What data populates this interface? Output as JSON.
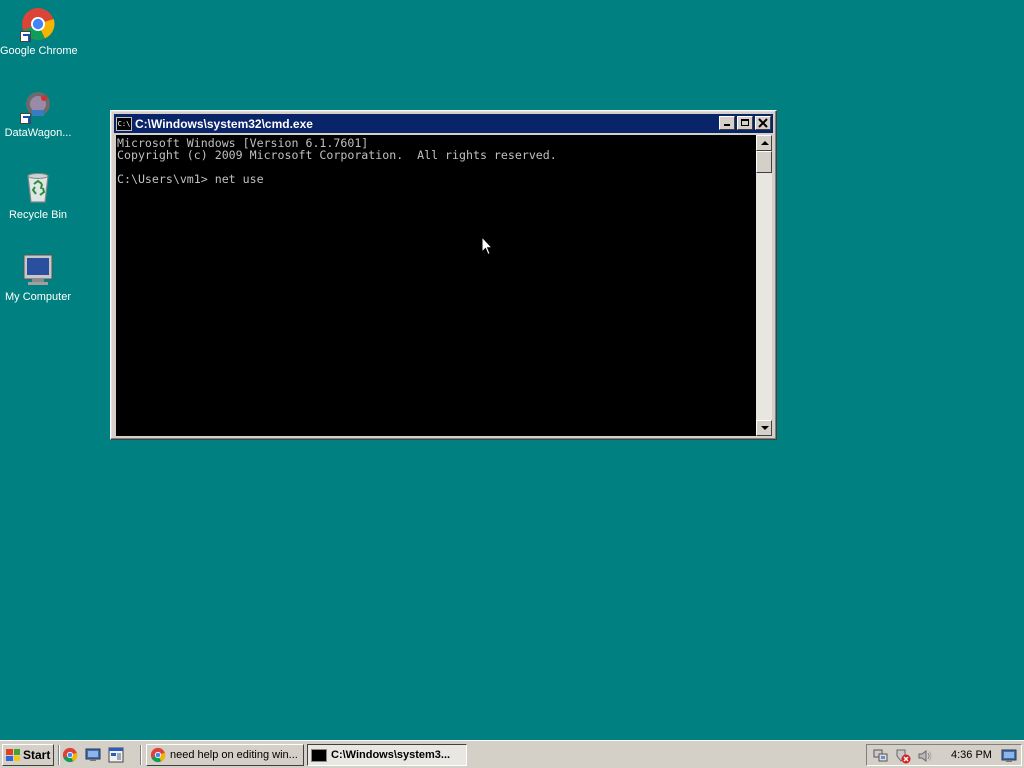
{
  "desktop": {
    "icons": [
      {
        "label": "Google Chrome",
        "icon": "chrome-icon"
      },
      {
        "label": "DataWagon...",
        "icon": "datawagon-icon"
      },
      {
        "label": "Recycle Bin",
        "icon": "recycle-bin-icon"
      },
      {
        "label": "My Computer",
        "icon": "my-computer-icon"
      }
    ]
  },
  "window": {
    "title": "C:\\Windows\\system32\\cmd.exe",
    "sys_icon_text": "C:\\",
    "console": {
      "lines": [
        "Microsoft Windows [Version 6.1.7601]",
        "Copyright (c) 2009 Microsoft Corporation.  All rights reserved.",
        "",
        "C:\\Users\\vm1> net use"
      ]
    }
  },
  "taskbar": {
    "start_label": "Start",
    "quick_launch": [
      "chrome-icon",
      "show-desktop-icon",
      "explorer-icon"
    ],
    "tasks": [
      {
        "label": "need help on editing win...",
        "icon": "chrome-icon",
        "active": false
      },
      {
        "label": "C:\\Windows\\system3...",
        "icon": "cmd-icon",
        "active": true
      }
    ],
    "tray_icons": [
      "network-icon",
      "security-alert-icon",
      "volume-icon"
    ],
    "clock": "4:36 PM"
  },
  "colors": {
    "desktop": "#008080",
    "titlebar": "#0a246a",
    "console_bg": "#000000",
    "console_fg": "#c0c0c0",
    "chrome": "#d4d0c8"
  }
}
